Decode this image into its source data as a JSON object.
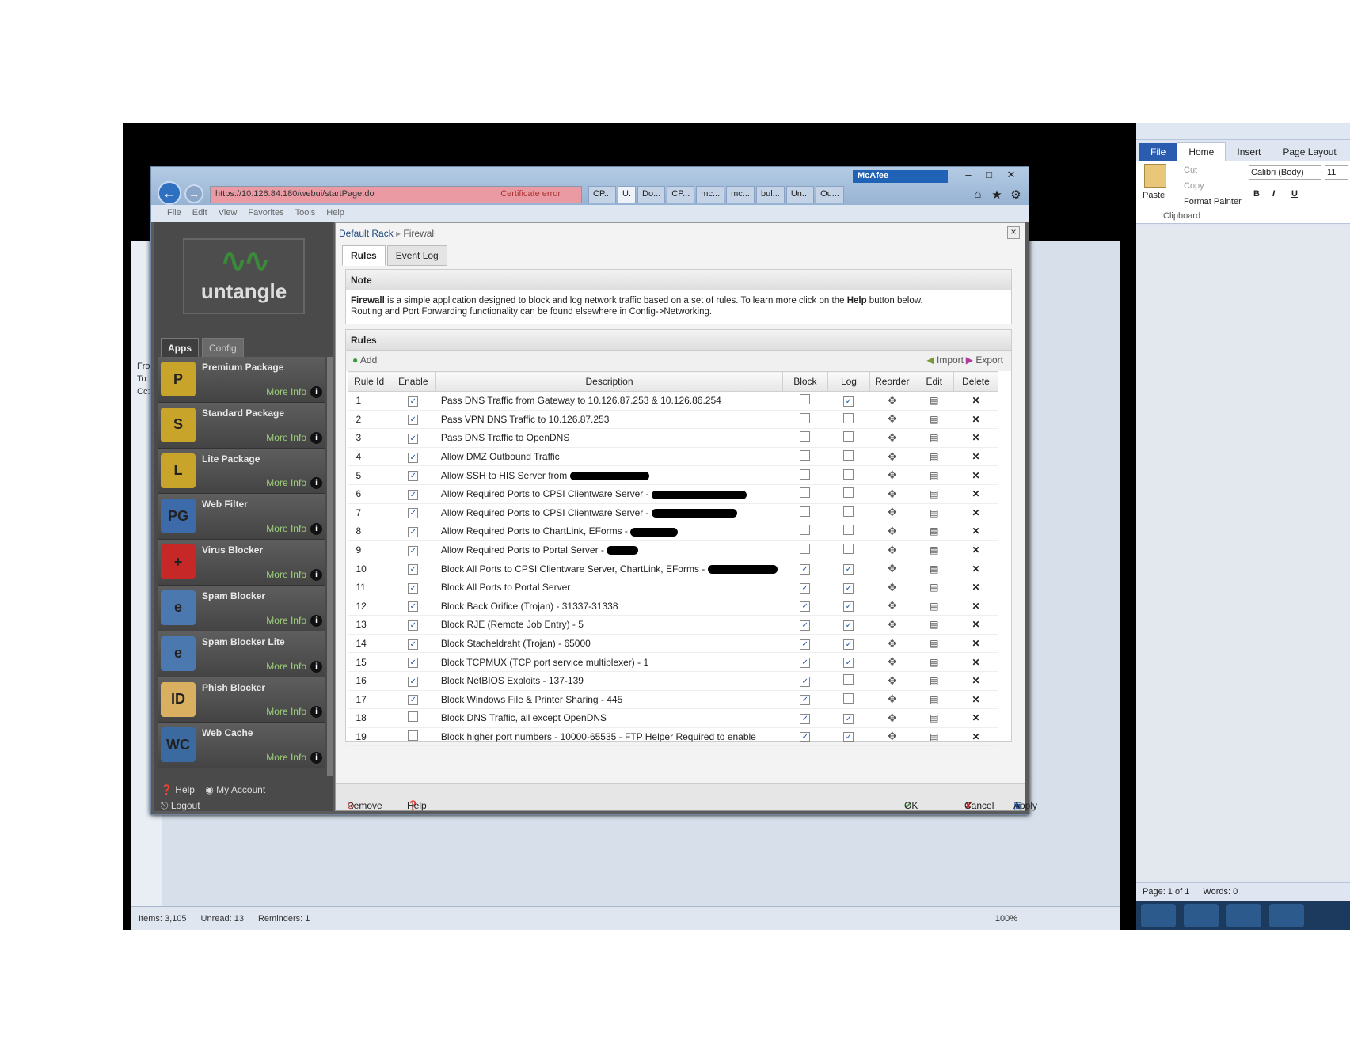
{
  "outlook": {
    "status_items": "Items: 3,105",
    "status_unread": "Unread: 13",
    "status_reminders": "Reminders: 1",
    "zoom": "100%",
    "from_label": "From",
    "to_label": "To:",
    "cc_label": "Cc:"
  },
  "word": {
    "tabs": [
      "File",
      "Home",
      "Insert",
      "Page Layout"
    ],
    "cut": "Cut",
    "copy": "Copy",
    "paste": "Paste",
    "format_painter": "Format Painter",
    "clipboard": "Clipboard",
    "font": "Calibri (Body)",
    "font_size": "11",
    "page_status": "Page: 1 of 1",
    "words_status": "Words: 0"
  },
  "browser": {
    "address": "https://10.126.84.180/webui/startPage.do",
    "cert_error": "Certificate error",
    "mcafee": "McAfee",
    "tabs": [
      "CP...",
      "U.",
      "Do...",
      "CP...",
      "mc...",
      "mc...",
      "bul...",
      "Un...",
      "Ou..."
    ],
    "menu": [
      "File",
      "Edit",
      "View",
      "Favorites",
      "Tools",
      "Help"
    ]
  },
  "sidebar": {
    "logo_text": "untangle",
    "tab_apps": "Apps",
    "tab_config": "Config",
    "apps": [
      {
        "name": "Premium Package",
        "more": "More Info",
        "icon": "P",
        "color": "#c9a42a"
      },
      {
        "name": "Standard Package",
        "more": "More Info",
        "icon": "S",
        "color": "#c9a42a"
      },
      {
        "name": "Lite Package",
        "more": "More Info",
        "icon": "L",
        "color": "#c9a42a"
      },
      {
        "name": "Web Filter",
        "more": "More Info",
        "icon": "PG",
        "color": "#3d6aa8"
      },
      {
        "name": "Virus Blocker",
        "more": "More Info",
        "icon": "+",
        "color": "#c62828"
      },
      {
        "name": "Spam Blocker",
        "more": "More Info",
        "icon": "e",
        "color": "#4c78b0"
      },
      {
        "name": "Spam Blocker Lite",
        "more": "More Info",
        "icon": "e",
        "color": "#4c78b0"
      },
      {
        "name": "Phish Blocker",
        "more": "More Info",
        "icon": "ID",
        "color": "#d8b060"
      },
      {
        "name": "Web Cache",
        "more": "More Info",
        "icon": "WC",
        "color": "#3a6aa0"
      }
    ],
    "help": "Help",
    "my_account": "My Account",
    "logout": "Logout"
  },
  "main": {
    "breadcrumb_root": "Default Rack",
    "breadcrumb_current": "Firewall",
    "tabs": [
      "Rules",
      "Event Log"
    ],
    "note_header": "Note",
    "note_bold1": "Firewall",
    "note_text1": " is a simple application designed to block and log network traffic based on a set of rules. To learn more click on the ",
    "note_bold2": "Help",
    "note_text2": " button below.",
    "note_line2": "Routing and Port Forwarding functionality can be found elsewhere in Config->Networking.",
    "rules_header": "Rules",
    "add": "Add",
    "import": "Import",
    "export": "Export",
    "columns": [
      "Rule Id",
      "Enable",
      "Description",
      "Block",
      "Log",
      "Reorder",
      "Edit",
      "Delete"
    ],
    "rules": [
      {
        "id": "1",
        "enable": true,
        "desc": "Pass DNS Traffic from Gateway to 10.126.87.253 & 10.126.86.254",
        "redact": 0,
        "block": false,
        "log": true
      },
      {
        "id": "2",
        "enable": true,
        "desc": "Pass VPN DNS Traffic to 10.126.87.253",
        "redact": 0,
        "block": false,
        "log": false
      },
      {
        "id": "3",
        "enable": true,
        "desc": "Pass DNS Traffic to OpenDNS",
        "redact": 0,
        "block": false,
        "log": false
      },
      {
        "id": "4",
        "enable": true,
        "desc": "Allow DMZ Outbound Traffic",
        "redact": 0,
        "block": false,
        "log": false
      },
      {
        "id": "5",
        "enable": true,
        "desc": "Allow SSH to HIS Server from",
        "redact": 1,
        "block": false,
        "log": false
      },
      {
        "id": "6",
        "enable": true,
        "desc": "Allow Required Ports to CPSI Clientware Server -",
        "redact": 1,
        "block": false,
        "log": false
      },
      {
        "id": "7",
        "enable": true,
        "desc": "Allow Required Ports to CPSI Clientware Server -",
        "redact": 1,
        "block": false,
        "log": false
      },
      {
        "id": "8",
        "enable": true,
        "desc": "Allow Required Ports to ChartLink, EForms -",
        "redact": 1,
        "block": false,
        "log": false
      },
      {
        "id": "9",
        "enable": true,
        "desc": "Allow Required Ports to Portal Server -",
        "redact": 1,
        "block": false,
        "log": false
      },
      {
        "id": "10",
        "enable": true,
        "desc": "Block All Ports to CPSI Clientware Server, ChartLink, EForms -",
        "redact": 1,
        "block": true,
        "log": true
      },
      {
        "id": "11",
        "enable": true,
        "desc": "Block All Ports to Portal Server",
        "redact": 0,
        "block": true,
        "log": true
      },
      {
        "id": "12",
        "enable": true,
        "desc": "Block Back Orifice (Trojan) - 31337-31338",
        "redact": 0,
        "block": true,
        "log": true
      },
      {
        "id": "13",
        "enable": true,
        "desc": "Block RJE (Remote Job Entry) - 5",
        "redact": 0,
        "block": true,
        "log": true
      },
      {
        "id": "14",
        "enable": true,
        "desc": "Block Stacheldraht (Trojan) - 65000",
        "redact": 0,
        "block": true,
        "log": true
      },
      {
        "id": "15",
        "enable": true,
        "desc": "Block TCPMUX (TCP port service multiplexer) - 1",
        "redact": 0,
        "block": true,
        "log": true
      },
      {
        "id": "16",
        "enable": true,
        "desc": "Block NetBIOS Exploits - 137-139",
        "redact": 0,
        "block": true,
        "log": false
      },
      {
        "id": "17",
        "enable": true,
        "desc": "Block Windows File & Printer Sharing - 445",
        "redact": 0,
        "block": true,
        "log": false
      },
      {
        "id": "18",
        "enable": false,
        "desc": "Block DNS Traffic, all except OpenDNS",
        "redact": 0,
        "block": true,
        "log": true
      },
      {
        "id": "19",
        "enable": false,
        "desc": "Block higher port numbers - 10000-65535 - FTP Helper Required to enable",
        "redact": 0,
        "block": true,
        "log": true
      }
    ],
    "remove": "Remove",
    "help": "Help",
    "ok": "OK",
    "cancel": "Cancel",
    "apply": "Apply"
  }
}
